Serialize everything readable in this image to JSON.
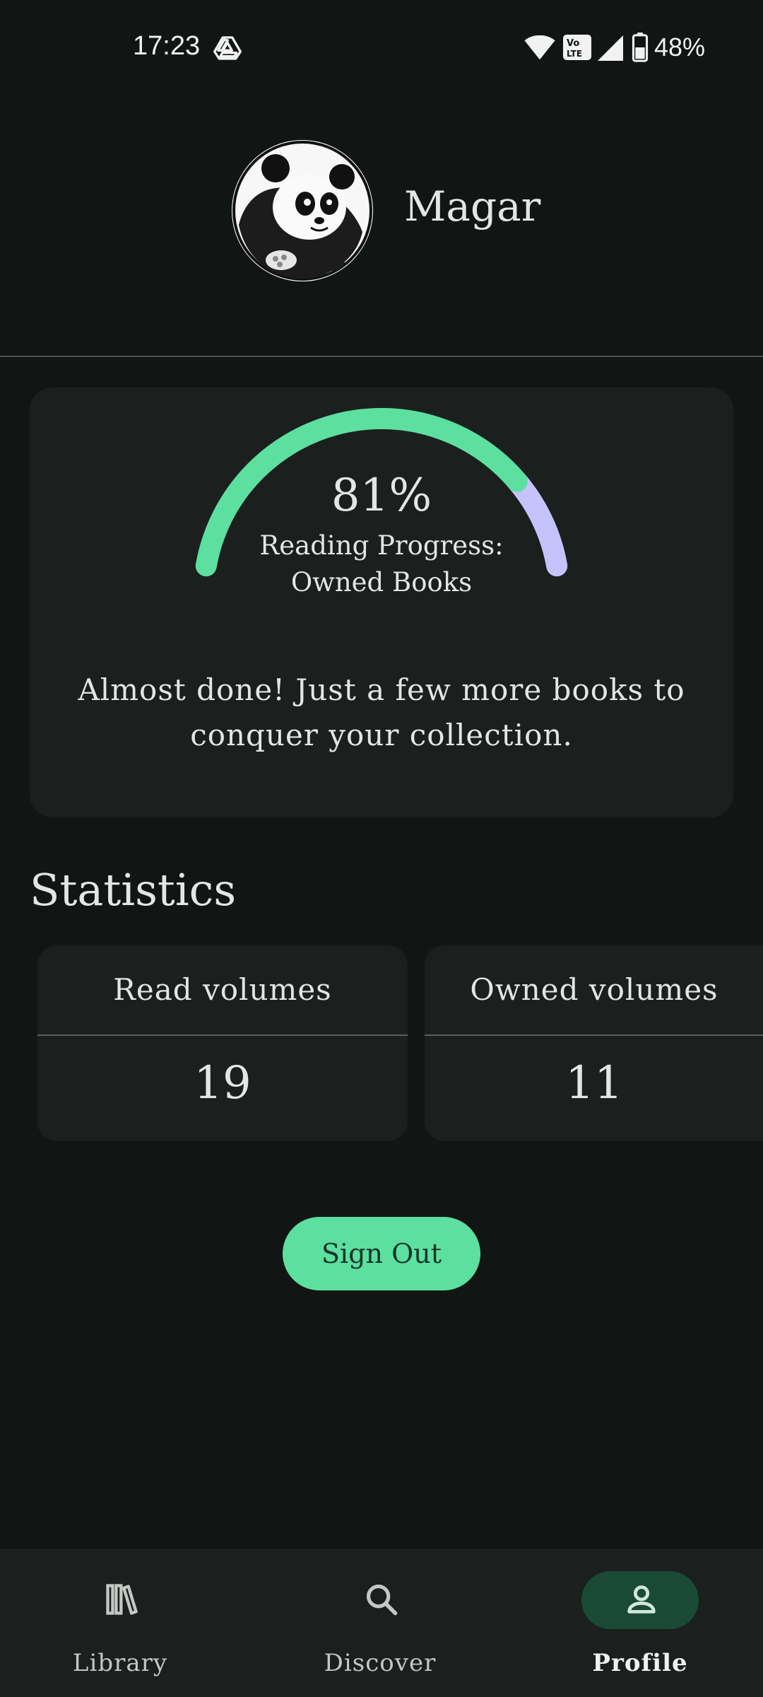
{
  "status_bar": {
    "time": "17:23",
    "battery": "48%",
    "icons": [
      "drive-icon",
      "wifi-icon",
      "volte-icon",
      "signal-icon",
      "battery-icon"
    ]
  },
  "profile": {
    "username": "Magar",
    "avatar_icon": "panda-avatar"
  },
  "progress": {
    "percent_text": "81%",
    "percent_value": 0.81,
    "label_line1": "Reading Progress:",
    "label_line2": "Owned Books",
    "message": "Almost done! Just a few more books to conquer your collection.",
    "colors": {
      "complete": "#5ddfa0",
      "remaining": "#c5c3fb"
    }
  },
  "statistics": {
    "title": "Statistics",
    "cards": [
      {
        "label": "Read volumes",
        "value": "19"
      },
      {
        "label": "Owned volumes",
        "value": "11"
      }
    ]
  },
  "actions": {
    "sign_out": "Sign Out"
  },
  "nav": {
    "items": [
      {
        "label": "Library",
        "icon": "library-icon",
        "selected": false
      },
      {
        "label": "Discover",
        "icon": "search-icon",
        "selected": false
      },
      {
        "label": "Profile",
        "icon": "person-icon",
        "selected": true
      }
    ]
  },
  "colors": {
    "background": "#111614",
    "card": "#1b201e",
    "accent": "#5ddfa0",
    "nav_selected": "#1a4a35"
  }
}
